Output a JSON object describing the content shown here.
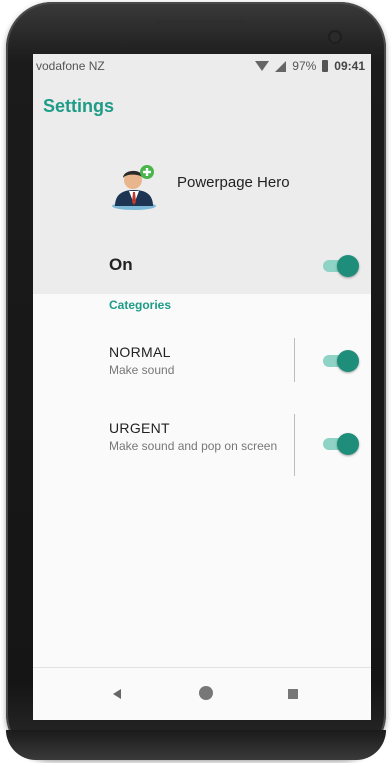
{
  "status_bar": {
    "carrier": "vodafone NZ",
    "battery": "97%",
    "time": "09:41",
    "icons": [
      "wifi-icon",
      "signal-icon",
      "battery-icon"
    ]
  },
  "header": {
    "title": "Settings",
    "app_name": "Powerpage Hero",
    "app_icon": "person-avatar-icon",
    "master_label": "On",
    "master_on": true
  },
  "categories": {
    "title": "Categories",
    "items": [
      {
        "name": "NORMAL",
        "description": "Make sound",
        "on": true
      },
      {
        "name": "URGENT",
        "description": "Make sound and pop on screen",
        "on": true
      }
    ]
  },
  "nav": {
    "icons": [
      "back-icon",
      "home-icon",
      "recents-icon"
    ]
  },
  "colors": {
    "accent": "#1e9c87",
    "toggle_thumb": "#1e8e7a",
    "toggle_track": "#8fd3c6"
  }
}
